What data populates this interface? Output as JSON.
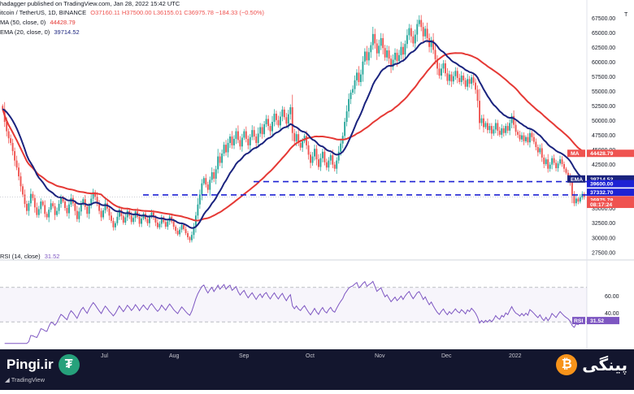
{
  "header": {
    "publisher": "hadagger published on TradingView.com, Jan 28, 2022 15:42 UTC",
    "symbol": "itcoin / TetherUS, 1D, BINANCE",
    "ohlc": "O37160.11  H37500.00  L36155.01  C36975.78  −184.33 (−0.50%)",
    "ma_legend": "MA (50, close, 0)",
    "ma_value": "44428.79",
    "ema_legend": "EMA (20, close, 0)",
    "ema_value": "39714.52"
  },
  "price_axis": {
    "currency_tag": "T",
    "ticks": [
      "67500.00",
      "65000.00",
      "62500.00",
      "60000.00",
      "57500.00",
      "55000.00",
      "52500.00",
      "50000.00",
      "47500.00",
      "45000.00",
      "42500.00",
      "35000.00",
      "32500.00",
      "30000.00",
      "27500.00"
    ]
  },
  "tags": {
    "ma_label": "MA",
    "ma_value": "44428.79",
    "ema_label": "EMA",
    "ema_value": "39714.52",
    "level_high": "39600.00",
    "level_low": "37332.70",
    "last_price": "36975.78",
    "countdown": "08:17:24"
  },
  "rsi": {
    "legend": "RSI (14, close)",
    "value": "31.52",
    "tag_label": "RSI",
    "tag_value": "31.52",
    "ticks": [
      "60.00",
      "40.00"
    ]
  },
  "time_axis": {
    "labels": [
      "Jul",
      "Aug",
      "Sep",
      "Oct",
      "Nov",
      "Dec",
      "2022"
    ]
  },
  "branding": {
    "left_text": "Pingi.ir",
    "tether_glyph": "₮",
    "tradingview": "TradingView",
    "right_text": "پینگی",
    "bitcoin_glyph": "₿"
  },
  "colors": {
    "up": "#26a69a",
    "down": "#ef5350",
    "ma": "#e53935",
    "ema": "#1a237e",
    "rsi": "#7e57c2",
    "levels": "#1e22d4",
    "brand_bg": "#13162e"
  },
  "chart_data": {
    "type": "candlestick",
    "symbol": "BTC/USDT",
    "timeframe": "1D",
    "y_range": [
      26500,
      69500
    ],
    "closes": [
      52000,
      49800,
      48200,
      47000,
      46200,
      44800,
      43200,
      42000,
      40500,
      38800,
      37400,
      35800,
      34600,
      35900,
      37500,
      36800,
      35200,
      33900,
      34900,
      36200,
      35600,
      34100,
      33500,
      34800,
      35900,
      35400,
      33900,
      34600,
      35800,
      36900,
      36200,
      35100,
      34200,
      35700,
      36800,
      35900,
      34600,
      33200,
      34500,
      35800,
      36600,
      35300,
      34100,
      35500,
      36700,
      37800,
      37000,
      35800,
      34600,
      33500,
      34700,
      35900,
      35000,
      33800,
      32900,
      31800,
      32500,
      33600,
      34800,
      33700,
      32600,
      33500,
      34600,
      33800,
      32700,
      33400,
      34500,
      33600,
      32400,
      33300,
      34100,
      33200,
      32500,
      33600,
      34300,
      33500,
      32600,
      31800,
      32400,
      33500,
      32700,
      31900,
      32800,
      33600,
      32800,
      31900,
      31200,
      30600,
      31400,
      32200,
      31500,
      30800,
      30100,
      29600,
      30500,
      31900,
      33800,
      35700,
      37400,
      39300,
      40200,
      39100,
      38200,
      39900,
      41200,
      40100,
      41700,
      43900,
      42800,
      44400,
      45900,
      44600,
      46200,
      47300,
      45800,
      46900,
      48200,
      46700,
      45600,
      47100,
      48200,
      46900,
      45800,
      47200,
      48400,
      47300,
      46200,
      47800,
      48900,
      47700,
      49400,
      50300,
      49100,
      48200,
      49800,
      51200,
      50100,
      49200,
      50700,
      51900,
      50600,
      49500,
      51100,
      52300,
      47900,
      46500,
      47700,
      46200,
      45400,
      46500,
      47400,
      45800,
      44200,
      42800,
      43900,
      45200,
      43400,
      42100,
      43600,
      44700,
      42900,
      42000,
      43200,
      44100,
      42500,
      41800,
      43200,
      44700,
      46100,
      47400,
      49800,
      51600,
      53700,
      54800,
      55400,
      56900,
      58200,
      56600,
      57900,
      60100,
      61800,
      60300,
      61700,
      62900,
      64800,
      63200,
      61500,
      62800,
      64100,
      62400,
      60800,
      62000,
      60600,
      59200,
      60400,
      61600,
      60200,
      61200,
      62600,
      61300,
      63100,
      64600,
      65800,
      64400,
      63200,
      64700,
      66500,
      67200,
      66000,
      64400,
      65700,
      64100,
      62600,
      63800,
      62100,
      60500,
      58900,
      57700,
      58900,
      59800,
      58100,
      56800,
      57900,
      56700,
      57600,
      58500,
      57300,
      56600,
      57700,
      56900,
      55800,
      57100,
      56300,
      57400,
      56500,
      55300,
      53400,
      49600,
      50400,
      48900,
      49600,
      48400,
      49100,
      47800,
      48500,
      49600,
      48300,
      47600,
      48700,
      47900,
      49100,
      48300,
      49600,
      50800,
      49300,
      48100,
      47600,
      46800,
      47500,
      46500,
      47200,
      46300,
      47900,
      47200,
      46400,
      45500,
      44600,
      45300,
      43700,
      42600,
      43400,
      41800,
      42500,
      43600,
      42800,
      41900,
      42700,
      43400,
      42600,
      41800,
      41100,
      40500,
      39500,
      37200,
      35900,
      36700,
      36200,
      36900,
      37500,
      36975
    ]
  }
}
